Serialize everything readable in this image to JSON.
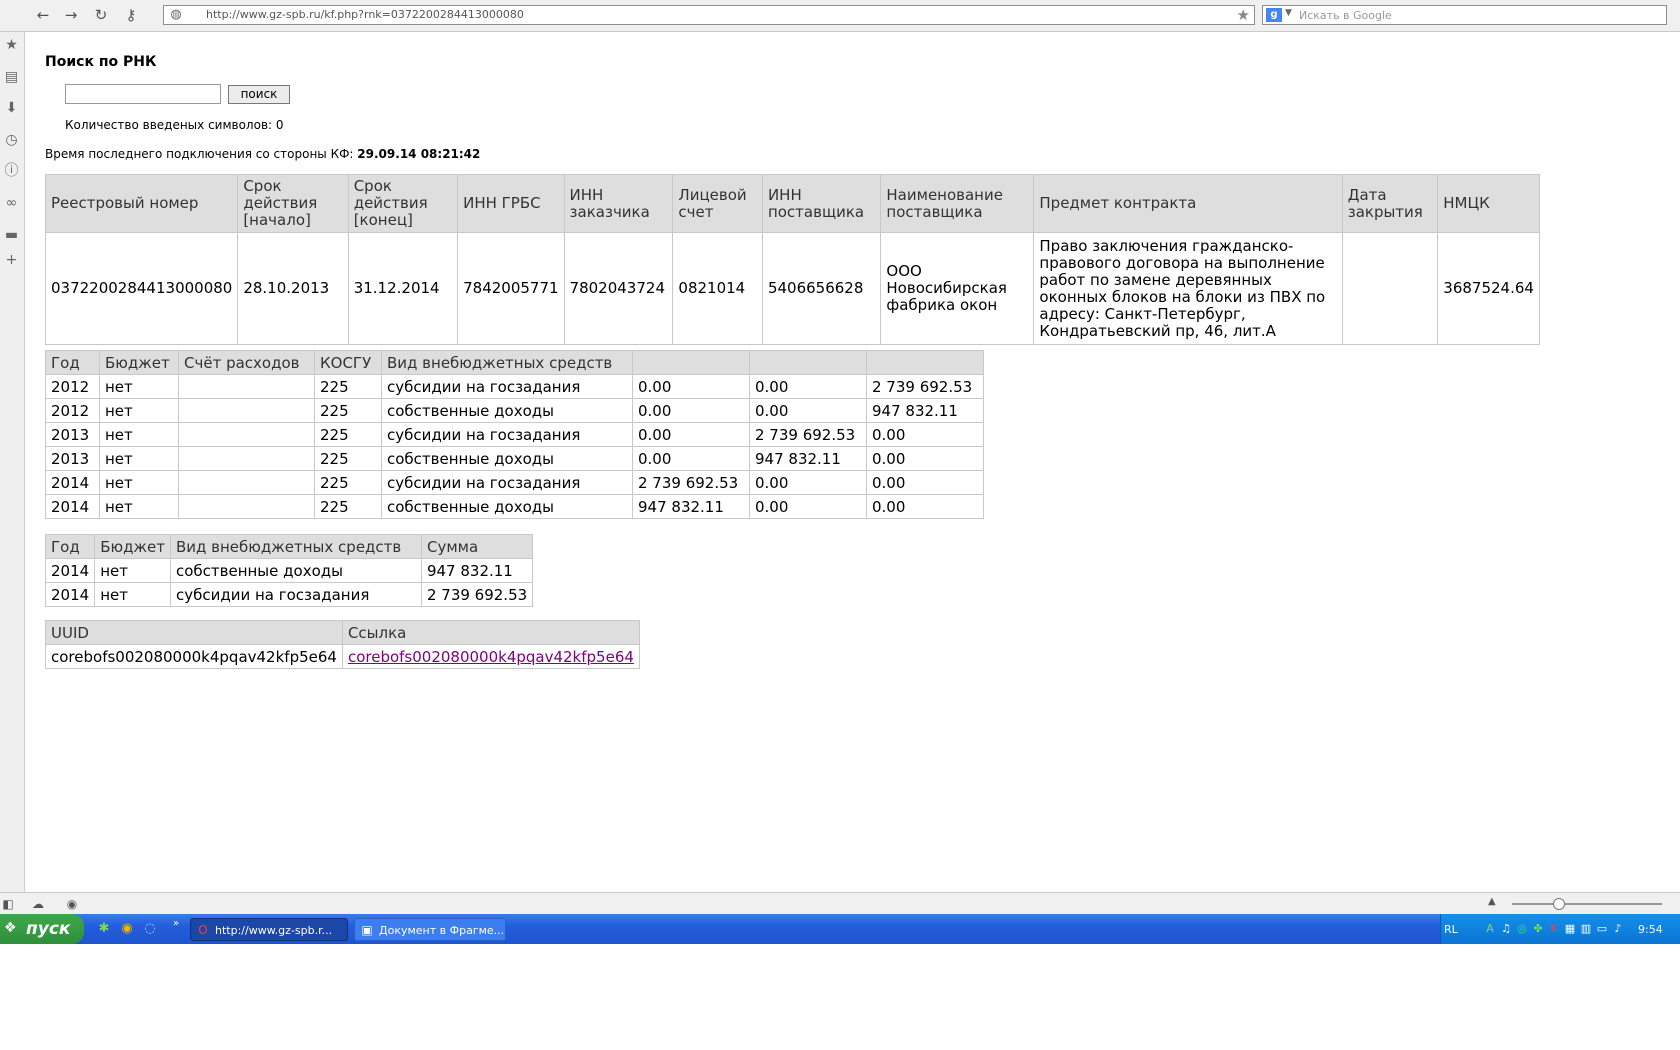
{
  "browser": {
    "url": "http://www.gz-spb.ru/kf.php?rnk=0372200284413000080",
    "search_placeholder": "Искать в Google"
  },
  "page": {
    "title": "Поиск по РНК",
    "search_button": "поиск",
    "char_count_label": "Количество введеных символов: 0",
    "last_conn_label": "Время последнего подключения со стороны КФ:",
    "last_conn_value": "29.09.14 08:21:42"
  },
  "contract_table": {
    "headers": [
      "Реестровый номер",
      "Срок действия [начало]",
      "Срок действия [конец]",
      "ИНН ГРБС",
      "ИНН заказчика",
      "Лицевой счет",
      "ИНН поставщика",
      "Наименование поставщика",
      "Предмет контракта",
      "Дата закрытия",
      "НМЦК"
    ],
    "row": [
      "0372200284413000080",
      "28.10.2013",
      "31.12.2014",
      "7842005771",
      "7802043724",
      "0821014",
      "5406656628",
      "ООО Новосибирская фабрика окон",
      "Право заключения гражданско-правового договора на выполнение работ по замене деревянных оконных блоков на блоки из ПВХ по адресу: Санкт-Петербург, Кондратьевский пр, 46, лит.А",
      "",
      "3687524.64"
    ]
  },
  "budget_table": {
    "headers": [
      "Год",
      "Бюджет",
      "Счёт расходов",
      "КОСГУ",
      "Вид внебюджетных средств",
      "",
      "",
      ""
    ],
    "rows": [
      [
        "2012",
        "нет",
        "",
        "225",
        "субсидии на госзадания",
        "0.00",
        "0.00",
        "2 739 692.53"
      ],
      [
        "2012",
        "нет",
        "",
        "225",
        "собственные доходы",
        "0.00",
        "0.00",
        "947 832.11"
      ],
      [
        "2013",
        "нет",
        "",
        "225",
        "субсидии на госзадания",
        "0.00",
        "2 739 692.53",
        "0.00"
      ],
      [
        "2013",
        "нет",
        "",
        "225",
        "собственные доходы",
        "0.00",
        "947 832.11",
        "0.00"
      ],
      [
        "2014",
        "нет",
        "",
        "225",
        "субсидии на госзадания",
        "2 739 692.53",
        "0.00",
        "0.00"
      ],
      [
        "2014",
        "нет",
        "",
        "225",
        "собственные доходы",
        "947 832.11",
        "0.00",
        "0.00"
      ]
    ]
  },
  "sum_table": {
    "headers": [
      "Год",
      "Бюджет",
      "Вид внебюджетных средств",
      "Сумма"
    ],
    "rows": [
      [
        "2014",
        "нет",
        "собственные доходы",
        "947 832.11"
      ],
      [
        "2014",
        "нет",
        "субсидии на госзадания",
        "2 739 692.53"
      ]
    ]
  },
  "uuid_table": {
    "headers": [
      "UUID",
      "Ссылка"
    ],
    "row": [
      "corebofs002080000k4pqav42kfp5e64",
      "corebofs002080000k4pqav42kfp5e64"
    ]
  },
  "taskbar": {
    "start": "пуск",
    "task1": "http://www.gz-spb.r...",
    "task2": "Документ в Фрагме...",
    "lang": "RL",
    "clock": "9:54"
  },
  "colors": {
    "taskbar": "#245edb",
    "start": "#3fa84b",
    "link": "#800080",
    "header_bg": "#dedede"
  }
}
